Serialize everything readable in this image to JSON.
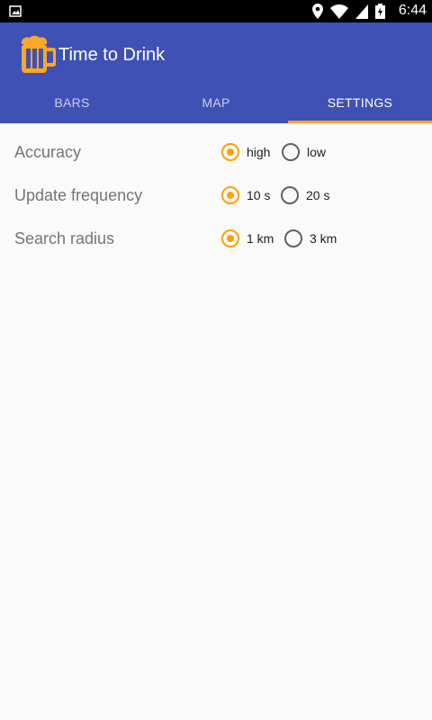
{
  "status_bar": {
    "time": "6:44",
    "icons": [
      "image-notification-icon",
      "location-icon",
      "wifi-icon",
      "cell-signal-icon",
      "battery-charging-icon"
    ]
  },
  "app_bar": {
    "title": "Time to Drink",
    "logo_icon": "beer-mug-icon",
    "primary_color": "#3f51b5",
    "accent_color": "#ffa726"
  },
  "tabs": [
    {
      "label": "BARS",
      "active": false
    },
    {
      "label": "MAP",
      "active": false
    },
    {
      "label": "SETTINGS",
      "active": true
    }
  ],
  "settings": [
    {
      "label": "Accuracy",
      "options": [
        {
          "label": "high",
          "checked": true
        },
        {
          "label": "low",
          "checked": false
        }
      ]
    },
    {
      "label": "Update frequency",
      "options": [
        {
          "label": "10 s",
          "checked": true
        },
        {
          "label": "20 s",
          "checked": false
        }
      ]
    },
    {
      "label": "Search radius",
      "options": [
        {
          "label": "1 km",
          "checked": true
        },
        {
          "label": "3 km",
          "checked": false
        }
      ]
    }
  ]
}
